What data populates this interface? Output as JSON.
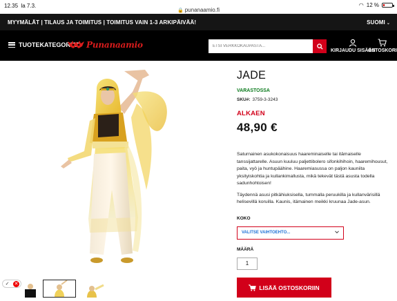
{
  "statusbar": {
    "time": "12.35",
    "date": "la 7.3.",
    "url": "punanaamio.fi",
    "battery": "12 %",
    "battery_level": 0.12
  },
  "topbar": {
    "promo": "MYYMÄLÄT | TILAUS JA TOIMITUS | TOIMITUS VAIN 1-3 ARKIPÄIVÄÄ!",
    "language": "SUOMI"
  },
  "header": {
    "menu_label": "TUOTEKATEGORIAT",
    "logo_text": "Punanaamio",
    "search_placeholder": "ETSI VERKKOKAUPASTA...",
    "login_label": "KIRJAUDU SISÄÄN",
    "cart_label": "OSTOSKORI"
  },
  "product": {
    "title": "JADE",
    "stock": "VARASTOSSA",
    "sku_label": "SKU#:",
    "sku": "3759-3-3243",
    "from_label": "ALKAEN",
    "price": "48,90 €",
    "description_1": "Saturnainen asukokonaisuus haareminaiselle tai itämaiselle tanssijattarelle. Asuun kuuluu paljettibolero sifonkihihoin, haaremihousut, paita, vyö ja huntupäähine. Haaremiasussa on paljon kauniita yksityiskohtia ja kullankimallusta, mikä tekevät tästä asusta todella sadunhohtoisen!",
    "description_2": "Täydennä asusi pitkähiuksisella, tummalla peruukilla ja kullanvärisillä helisevillä koruilla. Kaunis, itämainen meikki kruunaa Jade-asun.",
    "size_label": "KOKO",
    "size_placeholder": "VALITSE VAIHTOEHTO...",
    "quantity_label": "MÄÄRÄ",
    "quantity": "1",
    "add_to_cart": "LISÄÄ OSTOSKORIIN"
  },
  "colors": {
    "brand_red": "#d2001a",
    "stock_green": "#0a7a1c",
    "header_bg": "#000000"
  }
}
